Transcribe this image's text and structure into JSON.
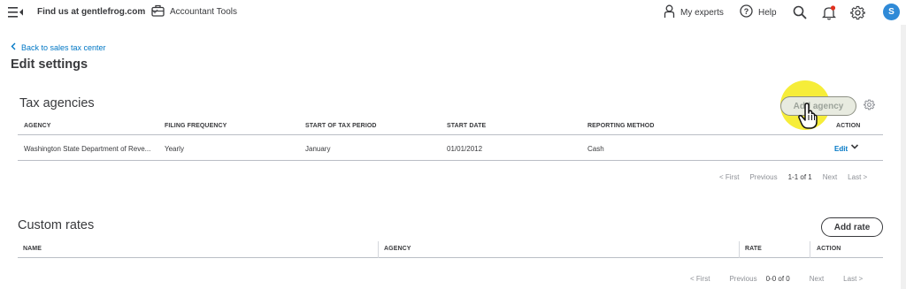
{
  "topbar": {
    "company_name": "Find us at gentlefrog.com",
    "accountant_tools": "Accountant Tools",
    "my_experts": "My experts",
    "help": "Help",
    "avatar_letter": "S"
  },
  "header": {
    "back_link": "Back to sales tax center",
    "title": "Edit settings"
  },
  "tax_agencies": {
    "title": "Tax agencies",
    "add_button": "Add agency",
    "columns": [
      "AGENCY",
      "FILING FREQUENCY",
      "START OF TAX PERIOD",
      "START DATE",
      "REPORTING METHOD",
      "ACTION"
    ],
    "rows": [
      {
        "agency": "Washington State Department of Reve...",
        "filing_frequency": "Yearly",
        "start_of_tax_period": "January",
        "start_date": "01/01/2012",
        "reporting_method": "Cash",
        "action": "Edit"
      }
    ],
    "pager": {
      "first": "< First",
      "previous": "Previous",
      "range": "1-1 of 1",
      "next": "Next",
      "last": "Last >"
    }
  },
  "custom_rates": {
    "title": "Custom rates",
    "add_button": "Add rate",
    "columns": [
      "NAME",
      "AGENCY",
      "RATE",
      "ACTION"
    ],
    "pager": {
      "first": "< First",
      "previous": "Previous",
      "range": "0-0 of 0",
      "next": "Next",
      "last": "Last >"
    }
  },
  "colors": {
    "link": "#0077c5",
    "text": "#393a3d",
    "highlight": "#f5eb28",
    "avatar": "#2f8ad7"
  }
}
